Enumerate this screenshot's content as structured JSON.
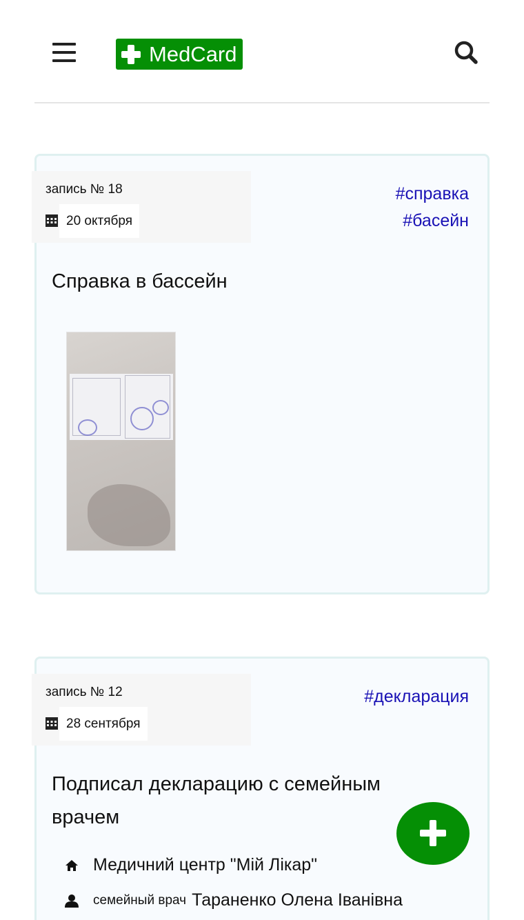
{
  "header": {
    "logo_text": "MedCard",
    "brand_color": "#058f05",
    "menu_icon": "hamburger-icon",
    "search_icon": "search-icon"
  },
  "records": [
    {
      "record_label": "запись №  18",
      "date": "20 октября",
      "tags": [
        "#справка",
        "#басейн"
      ],
      "title": "Справка в бассейн",
      "has_photo": true
    },
    {
      "record_label": "запись №  12",
      "date": "28 сентября",
      "tags": [
        "#декларация"
      ],
      "title": "Подписал декларацию с семейным врачем",
      "place": "Медичний центр \"Мій Лікар\"",
      "doctor_prefix": "семейный врач",
      "doctor_name": "Тараненко Олена Іванівна"
    }
  ],
  "fab_icon": "plus-icon",
  "tag_color": "#1a12b5"
}
